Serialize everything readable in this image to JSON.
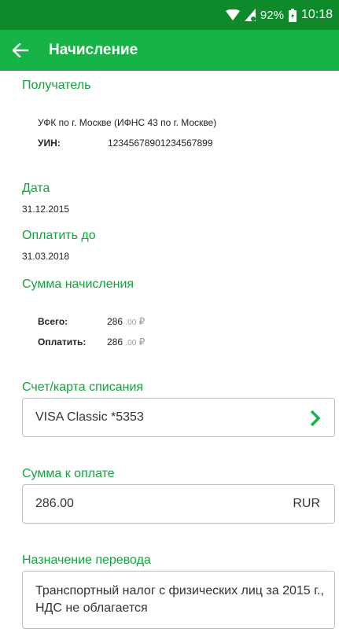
{
  "status": {
    "battery": "92%",
    "time": "10:18"
  },
  "appbar": {
    "title": "Начисление"
  },
  "recipient": {
    "heading": "Получатель",
    "name": "УФК по г. Москве (ИФНС 43 по г. Москве)",
    "uin_label": "УИН:",
    "uin_value": "12345678901234567899"
  },
  "date": {
    "heading": "Дата",
    "value": "31.12.2015"
  },
  "pay_by": {
    "heading": "Оплатить до",
    "value": "31.03.2018"
  },
  "amount": {
    "heading": "Сумма начисления",
    "total_label": "Всего:",
    "total_value": "286",
    "total_decimals": ".00",
    "pay_label": "Оплатить:",
    "pay_value": "286",
    "pay_decimals": ".00",
    "currency_symbol": "₽"
  },
  "account": {
    "heading": "Счет/карта списания",
    "value": "VISA Classic *5353"
  },
  "sum_to_pay": {
    "heading": "Сумма к оплате",
    "value": "286.00",
    "currency": "RUR"
  },
  "purpose": {
    "heading": "Назначение перевода",
    "line1": "Транспортный налог с физических лиц за 2015 г.,",
    "line2": "НДС не облагается"
  },
  "colors": {
    "status_bar": "#0e8a2a",
    "app_bar": "#17b346",
    "accent": "#12a33b"
  }
}
